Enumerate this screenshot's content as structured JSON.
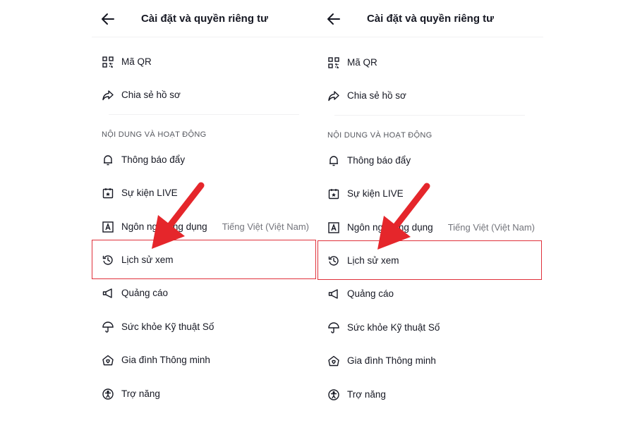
{
  "panels": [
    {
      "header": {
        "title": "Cài đặt và quyền riêng tư"
      },
      "items": {
        "qr": {
          "label": "Mã QR",
          "icon": "qr-code-icon"
        },
        "share": {
          "label": "Chia sẻ hồ sơ",
          "icon": "share-icon"
        },
        "section_title": "NỘI DUNG VÀ HOẠT ĐỘNG",
        "push": {
          "label": "Thông báo đẩy",
          "icon": "bell-icon"
        },
        "live": {
          "label": "Sự kiện LIVE",
          "icon": "calendar-star-icon"
        },
        "language": {
          "label": "Ngôn ngữ ứng dụng",
          "value": "Tiếng Việt (Việt Nam)",
          "icon": "language-icon"
        },
        "history": {
          "label": "Lịch sử xem",
          "icon": "history-clock-icon"
        },
        "ads": {
          "label": "Quảng cáo",
          "icon": "megaphone-icon"
        },
        "wellbeing": {
          "label": "Sức khỏe Kỹ thuật Số",
          "icon": "umbrella-icon"
        },
        "family": {
          "label": "Gia đình Thông minh",
          "icon": "home-heart-icon"
        },
        "accessibility": {
          "label": "Trợ năng",
          "icon": "accessibility-icon"
        }
      }
    },
    {
      "header": {
        "title": "Cài đặt và quyền riêng tư"
      },
      "items": {
        "qr": {
          "label": "Mã QR",
          "icon": "qr-code-icon"
        },
        "share": {
          "label": "Chia sẻ hồ sơ",
          "icon": "share-icon"
        },
        "section_title": "NỘI DUNG VÀ HOẠT ĐỘNG",
        "push": {
          "label": "Thông báo đẩy",
          "icon": "bell-icon"
        },
        "live": {
          "label": "Sự kiện LIVE",
          "icon": "calendar-star-icon"
        },
        "language": {
          "label": "Ngôn ngữ ứng dụng",
          "value": "Tiếng Việt (Việt Nam)",
          "icon": "language-icon"
        },
        "history": {
          "label": "Lịch sử xem",
          "icon": "history-clock-icon"
        },
        "ads": {
          "label": "Quảng cáo",
          "icon": "megaphone-icon"
        },
        "wellbeing": {
          "label": "Sức khỏe Kỹ thuật Số",
          "icon": "umbrella-icon"
        },
        "family": {
          "label": "Gia đình Thông minh",
          "icon": "home-heart-icon"
        },
        "accessibility": {
          "label": "Trợ năng",
          "icon": "accessibility-icon"
        }
      }
    }
  ],
  "annotation": {
    "highlight_color": "#e0303a",
    "arrow_color": "#e5262b",
    "highlight_target": "Lịch sử xem"
  }
}
